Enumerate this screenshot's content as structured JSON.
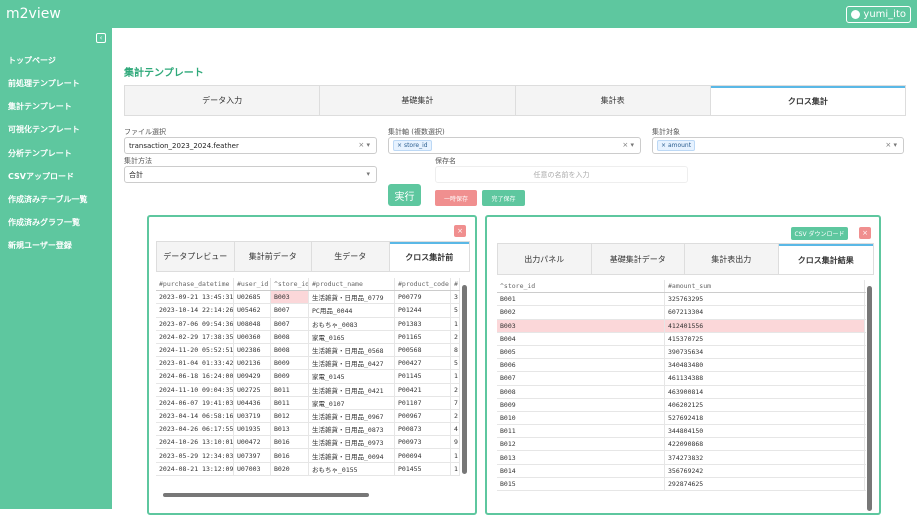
{
  "topbar": {
    "brand": "m2view",
    "user": "yumi_ito"
  },
  "sidebar": {
    "collapse_icon": "‹",
    "items": [
      {
        "label": "トップページ"
      },
      {
        "label": "前処理テンプレート"
      },
      {
        "label": "集計テンプレート"
      },
      {
        "label": "可視化テンプレート"
      },
      {
        "label": "分析テンプレート"
      },
      {
        "label": "CSVアップロード"
      },
      {
        "label": "作成済みテーブル一覧"
      },
      {
        "label": "作成済みグラフ一覧"
      },
      {
        "label": "新規ユーザー登録"
      }
    ]
  },
  "page": {
    "title": "集計テンプレート"
  },
  "tabs": [
    {
      "label": "データ入力"
    },
    {
      "label": "基礎集計"
    },
    {
      "label": "集計表"
    },
    {
      "label": "クロス集計",
      "active": true
    }
  ],
  "form": {
    "file_label": "ファイル選択",
    "file_value": "transaction_2023_2024.feather",
    "axis_label": "集計軸 (複数選択)",
    "axis_tag": "store_id",
    "target_label": "集計対象",
    "target_tag": "amount",
    "method_label": "集計方法",
    "method_value": "合計",
    "savename_label": "保存名",
    "savename_placeholder": "任意の名前を入力",
    "run_label": "実行",
    "tmp_save_label": "一時保存",
    "done_save_label": "完了保存"
  },
  "left_panel": {
    "tabs": [
      {
        "label": "データプレビュー"
      },
      {
        "label": "集計前データ"
      },
      {
        "label": "生データ"
      },
      {
        "label": "クロス集計前",
        "active": true
      }
    ],
    "columns": [
      "#purchase_datetime",
      "#user_id",
      "^store_id",
      "#product_name",
      "#product_code",
      "#"
    ],
    "rows": [
      [
        "2023-09-21 13:45:31",
        "U02685",
        "B003",
        "生活雑貨・日用品_0779",
        "P00779",
        "3"
      ],
      [
        "2023-10-14 22:14:26",
        "U05462",
        "B007",
        "PC用品_0044",
        "P01244",
        "5"
      ],
      [
        "2023-07-06 09:54:36",
        "U08048",
        "B007",
        "おもちゃ_0083",
        "P01383",
        "1"
      ],
      [
        "2024-02-29 17:38:35",
        "U00360",
        "B008",
        "家電_0165",
        "P01165",
        "2"
      ],
      [
        "2024-11-20 05:52:51",
        "U02386",
        "B008",
        "生活雑貨・日用品_0568",
        "P00568",
        "8"
      ],
      [
        "2023-01-04 01:33:42",
        "U02136",
        "B009",
        "生活雑貨・日用品_0427",
        "P00427",
        "5"
      ],
      [
        "2024-06-18 16:24:00",
        "U09429",
        "B009",
        "家電_0145",
        "P01145",
        "1"
      ],
      [
        "2024-11-10 09:04:35",
        "U02725",
        "B011",
        "生活雑貨・日用品_0421",
        "P00421",
        "2"
      ],
      [
        "2024-06-07 19:41:03",
        "U04436",
        "B011",
        "家電_0107",
        "P01107",
        "7"
      ],
      [
        "2023-04-14 06:58:16",
        "U03719",
        "B012",
        "生活雑貨・日用品_0967",
        "P00967",
        "2"
      ],
      [
        "2023-04-26 06:17:55",
        "U01935",
        "B013",
        "生活雑貨・日用品_0873",
        "P00873",
        "4"
      ],
      [
        "2024-10-26 13:10:01",
        "U00472",
        "B016",
        "生活雑貨・日用品_0973",
        "P00973",
        "9"
      ],
      [
        "2023-05-29 12:34:03",
        "U07397",
        "B016",
        "生活雑貨・日用品_0094",
        "P00094",
        "1"
      ],
      [
        "2024-08-21 13:12:09",
        "U07003",
        "B020",
        "おもちゃ_0155",
        "P01455",
        "1"
      ]
    ]
  },
  "right_panel": {
    "csv_label": "CSV ダウンロード",
    "tabs": [
      {
        "label": "出力パネル"
      },
      {
        "label": "基礎集計データ"
      },
      {
        "label": "集計表出力"
      },
      {
        "label": "クロス集計結果",
        "active": true
      }
    ],
    "columns": [
      "^store_id",
      "#amount_sum"
    ],
    "rows": [
      [
        "B001",
        "325763295"
      ],
      [
        "B002",
        "607213304"
      ],
      [
        "B003",
        "412401556"
      ],
      [
        "B004",
        "415370725"
      ],
      [
        "B005",
        "390735634"
      ],
      [
        "B006",
        "340483480"
      ],
      [
        "B007",
        "461134388"
      ],
      [
        "B008",
        "463900814"
      ],
      [
        "B009",
        "406202125"
      ],
      [
        "B010",
        "527692418"
      ],
      [
        "B011",
        "344804150"
      ],
      [
        "B012",
        "422090868"
      ],
      [
        "B013",
        "374273832"
      ],
      [
        "B014",
        "356769242"
      ],
      [
        "B015",
        "292874625"
      ]
    ]
  },
  "colors": {
    "accent": "#5ec79f",
    "danger": "#f08f8f",
    "highlight": "#fbd7d9",
    "tab_active": "#5ab8e6"
  }
}
